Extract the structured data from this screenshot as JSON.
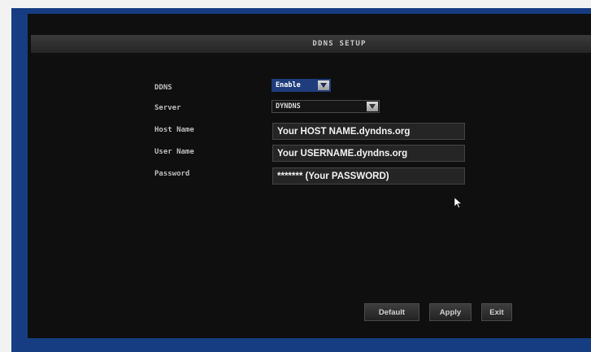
{
  "dialog": {
    "title": "DDNS SETUP"
  },
  "fields": {
    "ddns": {
      "label": "DDNS",
      "value": "Enable"
    },
    "server": {
      "label": "Server",
      "value": "DYNDNS"
    },
    "host_name": {
      "label": "Host  Name",
      "value": "Your HOST NAME.dyndns.org"
    },
    "user_name": {
      "label": "User  Name",
      "value": "Your USERNAME.dyndns.org"
    },
    "password": {
      "label": "Password",
      "value": "******* (Your PASSWORD)"
    }
  },
  "buttons": {
    "default": "Default",
    "apply": "Apply",
    "exit": "Exit"
  },
  "colors": {
    "frame": "#163d82",
    "screen": "#0f0f10",
    "selected": "#1f3d7d"
  },
  "icons": {
    "dropdown": "triangle-down-icon",
    "cursor": "mouse-pointer-icon"
  }
}
